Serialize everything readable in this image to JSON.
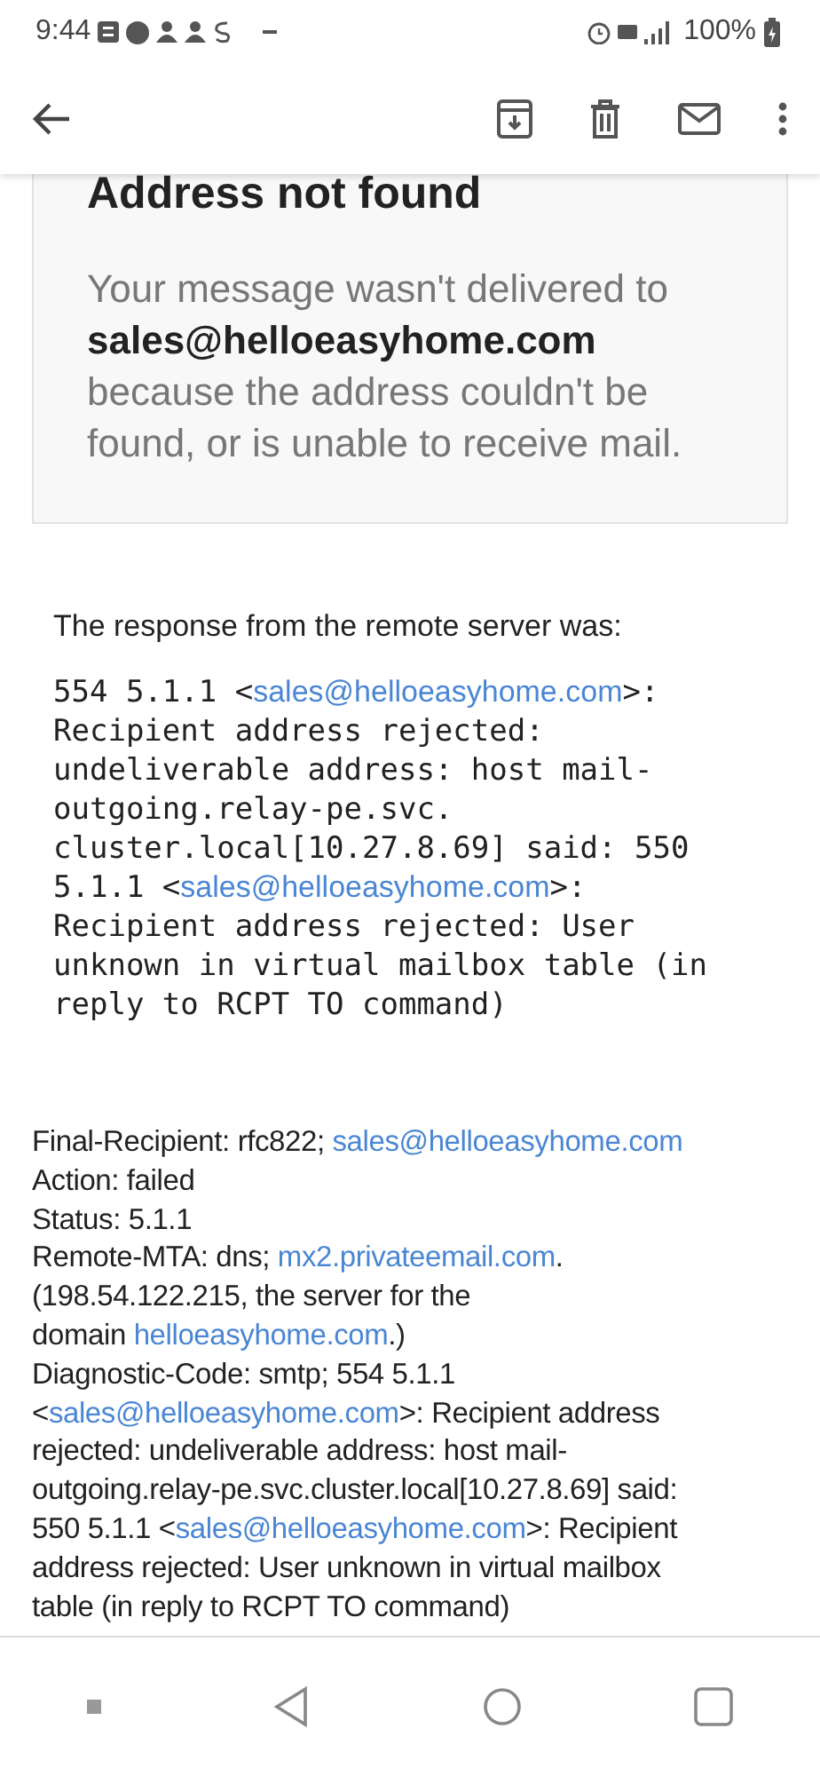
{
  "status_bar": {
    "time": "9:44",
    "battery": "100%"
  },
  "card": {
    "title": "Address not found",
    "message": [
      {
        "text": "Your message wasn't delivered to",
        "kind": "text"
      },
      {
        "text": "sales@helloeasyhome.com",
        "kind": "bold"
      },
      {
        "text": "because the address couldn't be found, or is unable to receive mail.",
        "kind": "text"
      }
    ]
  },
  "response": {
    "intro": "The response from the remote server was:",
    "lines": [
      [
        {
          "text": "554 5.1.1 <",
          "kind": "text"
        },
        {
          "text": "sales@helloeasyhome.com",
          "kind": "link"
        },
        {
          "text": ">:",
          "kind": "text"
        }
      ],
      [
        {
          "text": "Recipient address rejected:",
          "kind": "text"
        }
      ],
      [
        {
          "text": "undeliverable address: host mail-",
          "kind": "text"
        }
      ],
      [
        {
          "text": "outgoing.relay-pe.svc.",
          "kind": "text"
        }
      ],
      [
        {
          "text": "cluster.local[10.27.8.69] said: 550",
          "kind": "text"
        }
      ],
      [
        {
          "text": "5.1.1 <",
          "kind": "text"
        },
        {
          "text": "sales@helloeasyhome.com",
          "kind": "link"
        },
        {
          "text": ">:",
          "kind": "text"
        }
      ],
      [
        {
          "text": "Recipient address rejected: User",
          "kind": "text"
        }
      ],
      [
        {
          "text": "unknown in virtual mailbox table (in",
          "kind": "text"
        }
      ],
      [
        {
          "text": "reply to RCPT TO command)",
          "kind": "text"
        }
      ]
    ]
  },
  "details": {
    "lines": [
      [
        {
          "text": "Final-Recipient: rfc822; ",
          "kind": "text"
        },
        {
          "text": "sales@helloeasyhome.com",
          "kind": "link"
        }
      ],
      [
        {
          "text": "Action: failed",
          "kind": "text"
        }
      ],
      [
        {
          "text": "Status: 5.1.1",
          "kind": "text"
        }
      ],
      [
        {
          "text": "Remote-MTA: dns; ",
          "kind": "text"
        },
        {
          "text": "mx2.privateemail.com",
          "kind": "link"
        },
        {
          "text": ".",
          "kind": "text"
        }
      ],
      [
        {
          "text": "(198.54.122.215, the server for the",
          "kind": "text"
        }
      ],
      [
        {
          "text": " domain ",
          "kind": "text"
        },
        {
          "text": "helloeasyhome.com",
          "kind": "link"
        },
        {
          "text": ".)",
          "kind": "text"
        }
      ],
      [
        {
          "text": "Diagnostic-Code: smtp; 554 5.1.1",
          "kind": "text"
        }
      ],
      [
        {
          "text": "<",
          "kind": "text"
        },
        {
          "text": "sales@helloeasyhome.com",
          "kind": "link"
        },
        {
          "text": ">: Recipient address",
          "kind": "text"
        }
      ],
      [
        {
          "text": "rejected: undeliverable address: host mail-",
          "kind": "text"
        }
      ],
      [
        {
          "text": "outgoing.relay-pe.svc.cluster.local[10.27.8.69] said:",
          "kind": "text"
        }
      ],
      [
        {
          "text": "550 5.1.1 <",
          "kind": "text"
        },
        {
          "text": "sales@helloeasyhome.com",
          "kind": "link"
        },
        {
          "text": ">: Recipient",
          "kind": "text"
        }
      ],
      [
        {
          "text": "address rejected: User unknown in virtual mailbox",
          "kind": "text"
        }
      ],
      [
        {
          "text": "table (in reply to RCPT TO command)",
          "kind": "text"
        }
      ]
    ]
  }
}
